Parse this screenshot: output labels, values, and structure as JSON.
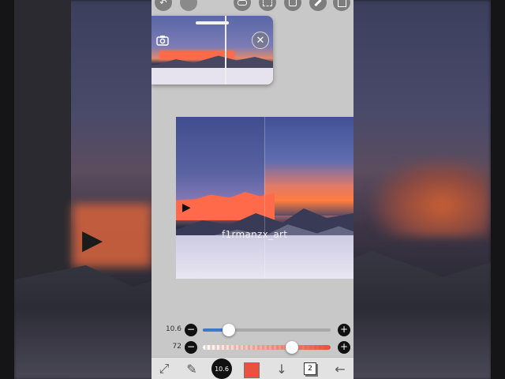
{
  "canvas": {
    "watermark": "f1rmanzx_art"
  },
  "sliders": {
    "brush_size": {
      "label": "10.6",
      "value_fraction": 0.17
    },
    "opacity": {
      "label": "72",
      "value_fraction": 0.72
    }
  },
  "controls": {
    "minus": "−",
    "plus": "+"
  },
  "bottom_bar": {
    "brush_size_label": "10.6",
    "layer_count": "2",
    "color_hex": "#e8523e"
  },
  "icons": {
    "undo": "↶",
    "camera": "📷",
    "close": "✕",
    "brush": "✎",
    "transform": "⤢",
    "down": "↓",
    "back": "←",
    "cursor": "▶"
  },
  "colors": {
    "accent_blue": "#3c79c9",
    "accent_red": "#e8523e"
  }
}
